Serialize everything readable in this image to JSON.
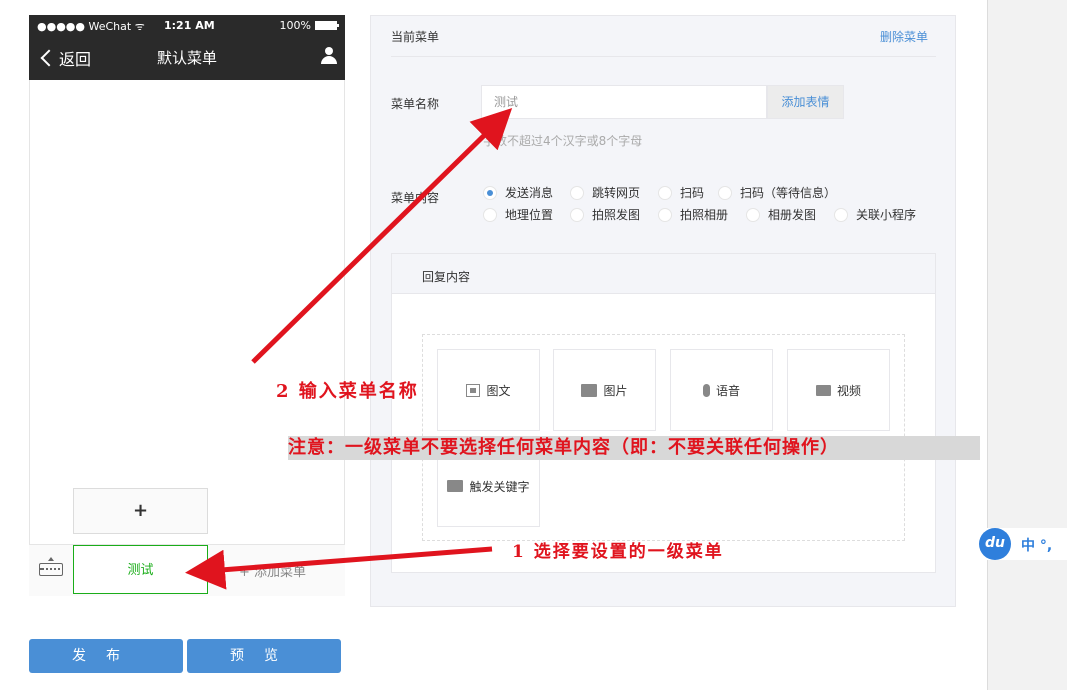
{
  "phone": {
    "status": {
      "carrier": "●●●●● WeChat ᯤ",
      "time": "1:21 AM",
      "battery": "100%"
    },
    "nav": {
      "back": "返回",
      "title": "默认菜单"
    },
    "submenu_add": "+",
    "menu_current": "测试",
    "menu_add": "+ 添加菜单"
  },
  "buttons": {
    "publish": "发布",
    "preview": "预览"
  },
  "editor": {
    "current_menu_label": "当前菜单",
    "delete_menu": "删除菜单",
    "name_label": "菜单名称",
    "name_value": "测试",
    "emoji_button": "添加表情",
    "name_hint": "字数不超过4个汉字或8个字母",
    "content_label": "菜单内容",
    "options": [
      {
        "label": "发送消息",
        "selected": true
      },
      {
        "label": "跳转网页",
        "selected": false
      },
      {
        "label": "扫码",
        "selected": false
      },
      {
        "label": "扫码（等待信息）",
        "selected": false
      },
      {
        "label": "地理位置",
        "selected": false
      },
      {
        "label": "拍照发图",
        "selected": false
      },
      {
        "label": "拍照相册",
        "selected": false
      },
      {
        "label": "相册发图",
        "selected": false
      },
      {
        "label": "关联小程序",
        "selected": false
      }
    ],
    "reply_title": "回复内容",
    "reply_types": [
      {
        "label": "图文",
        "icon": "news-icon"
      },
      {
        "label": "图片",
        "icon": "image-icon"
      },
      {
        "label": "语音",
        "icon": "voice-icon"
      },
      {
        "label": "视频",
        "icon": "video-icon"
      },
      {
        "label": "触发关键字",
        "icon": "folder-icon"
      }
    ]
  },
  "annotations": {
    "step2": "2 输入菜单名称",
    "note": "注意：一级菜单不要选择任何菜单内容（即：不要关联任何操作）",
    "step1": "1 选择要设置的一级菜单",
    "color": "#e0141e"
  },
  "ime": {
    "logo": "du",
    "text": "中 °,"
  },
  "colors": {
    "accent": "#4a8fd6",
    "green": "#1aad19",
    "navbar": "#2a2a2a"
  }
}
